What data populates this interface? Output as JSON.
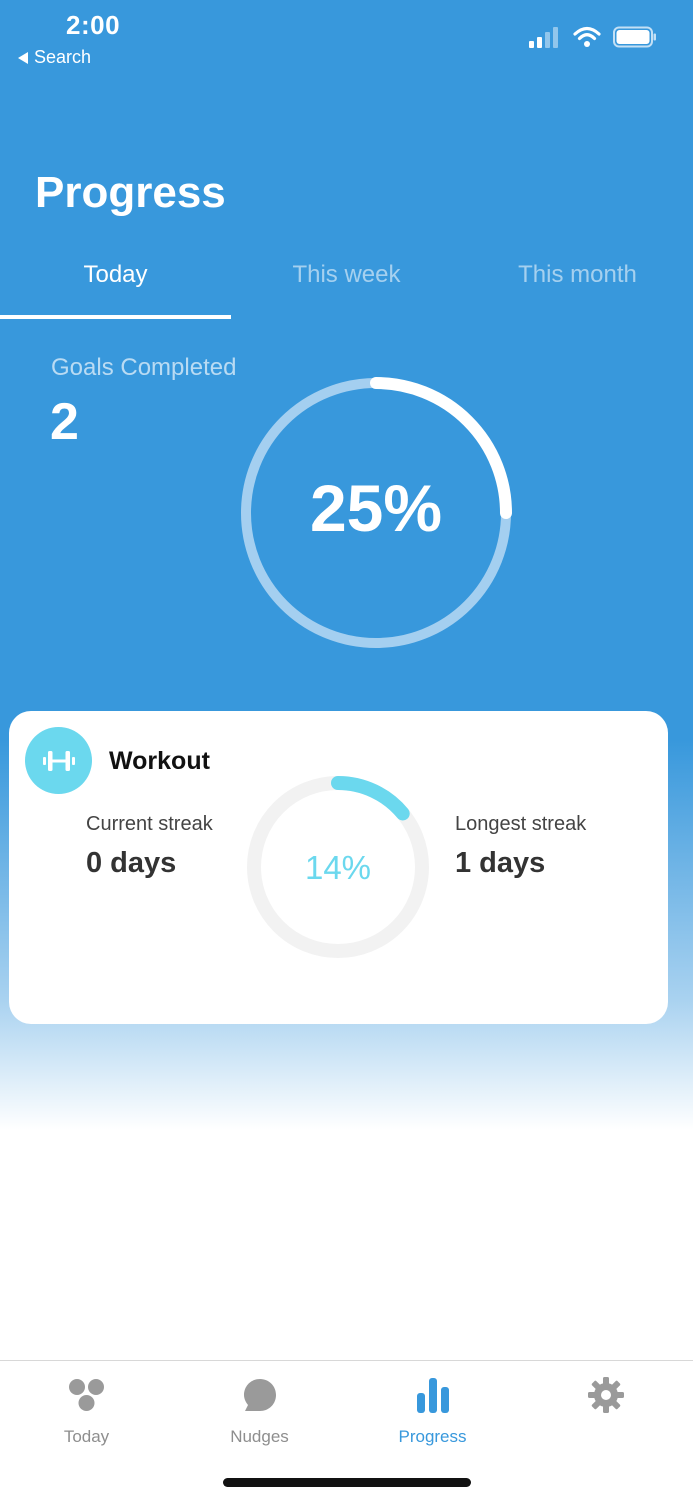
{
  "status_bar": {
    "time": "2:00",
    "back_label": "Search",
    "signal_icon": "signal-icon",
    "wifi_icon": "wifi-icon",
    "battery_icon": "battery-icon"
  },
  "page": {
    "title": "Progress"
  },
  "tabs": [
    {
      "label": "Today",
      "active": true
    },
    {
      "label": "This week",
      "active": false
    },
    {
      "label": "This month",
      "active": false
    }
  ],
  "summary": {
    "goals_label": "Goals Completed",
    "goals_value": "2",
    "percent_text": "25%",
    "percent_value": 25
  },
  "workout_card": {
    "icon": "dumbbell-icon",
    "title": "Workout",
    "current_streak_label": "Current streak",
    "current_streak_value": "0 days",
    "longest_streak_label": "Longest streak",
    "longest_streak_value": "1 days",
    "percent_text": "14%",
    "percent_value": 14
  },
  "tab_bar": [
    {
      "label": "Today",
      "icon": "dots-cluster-icon",
      "active": false
    },
    {
      "label": "Nudges",
      "icon": "chat-bubble-icon",
      "active": false
    },
    {
      "label": "Progress",
      "icon": "bar-chart-icon",
      "active": true
    },
    {
      "label": "",
      "icon": "gear-icon",
      "active": false
    }
  ],
  "colors": {
    "primary_blue": "#3898dc",
    "accent_cyan": "#6bd8ee",
    "ring_track_light": "#a4cff0",
    "ring_track_grey": "#f2f2f2",
    "tab_inactive": "#8e8e8e"
  }
}
